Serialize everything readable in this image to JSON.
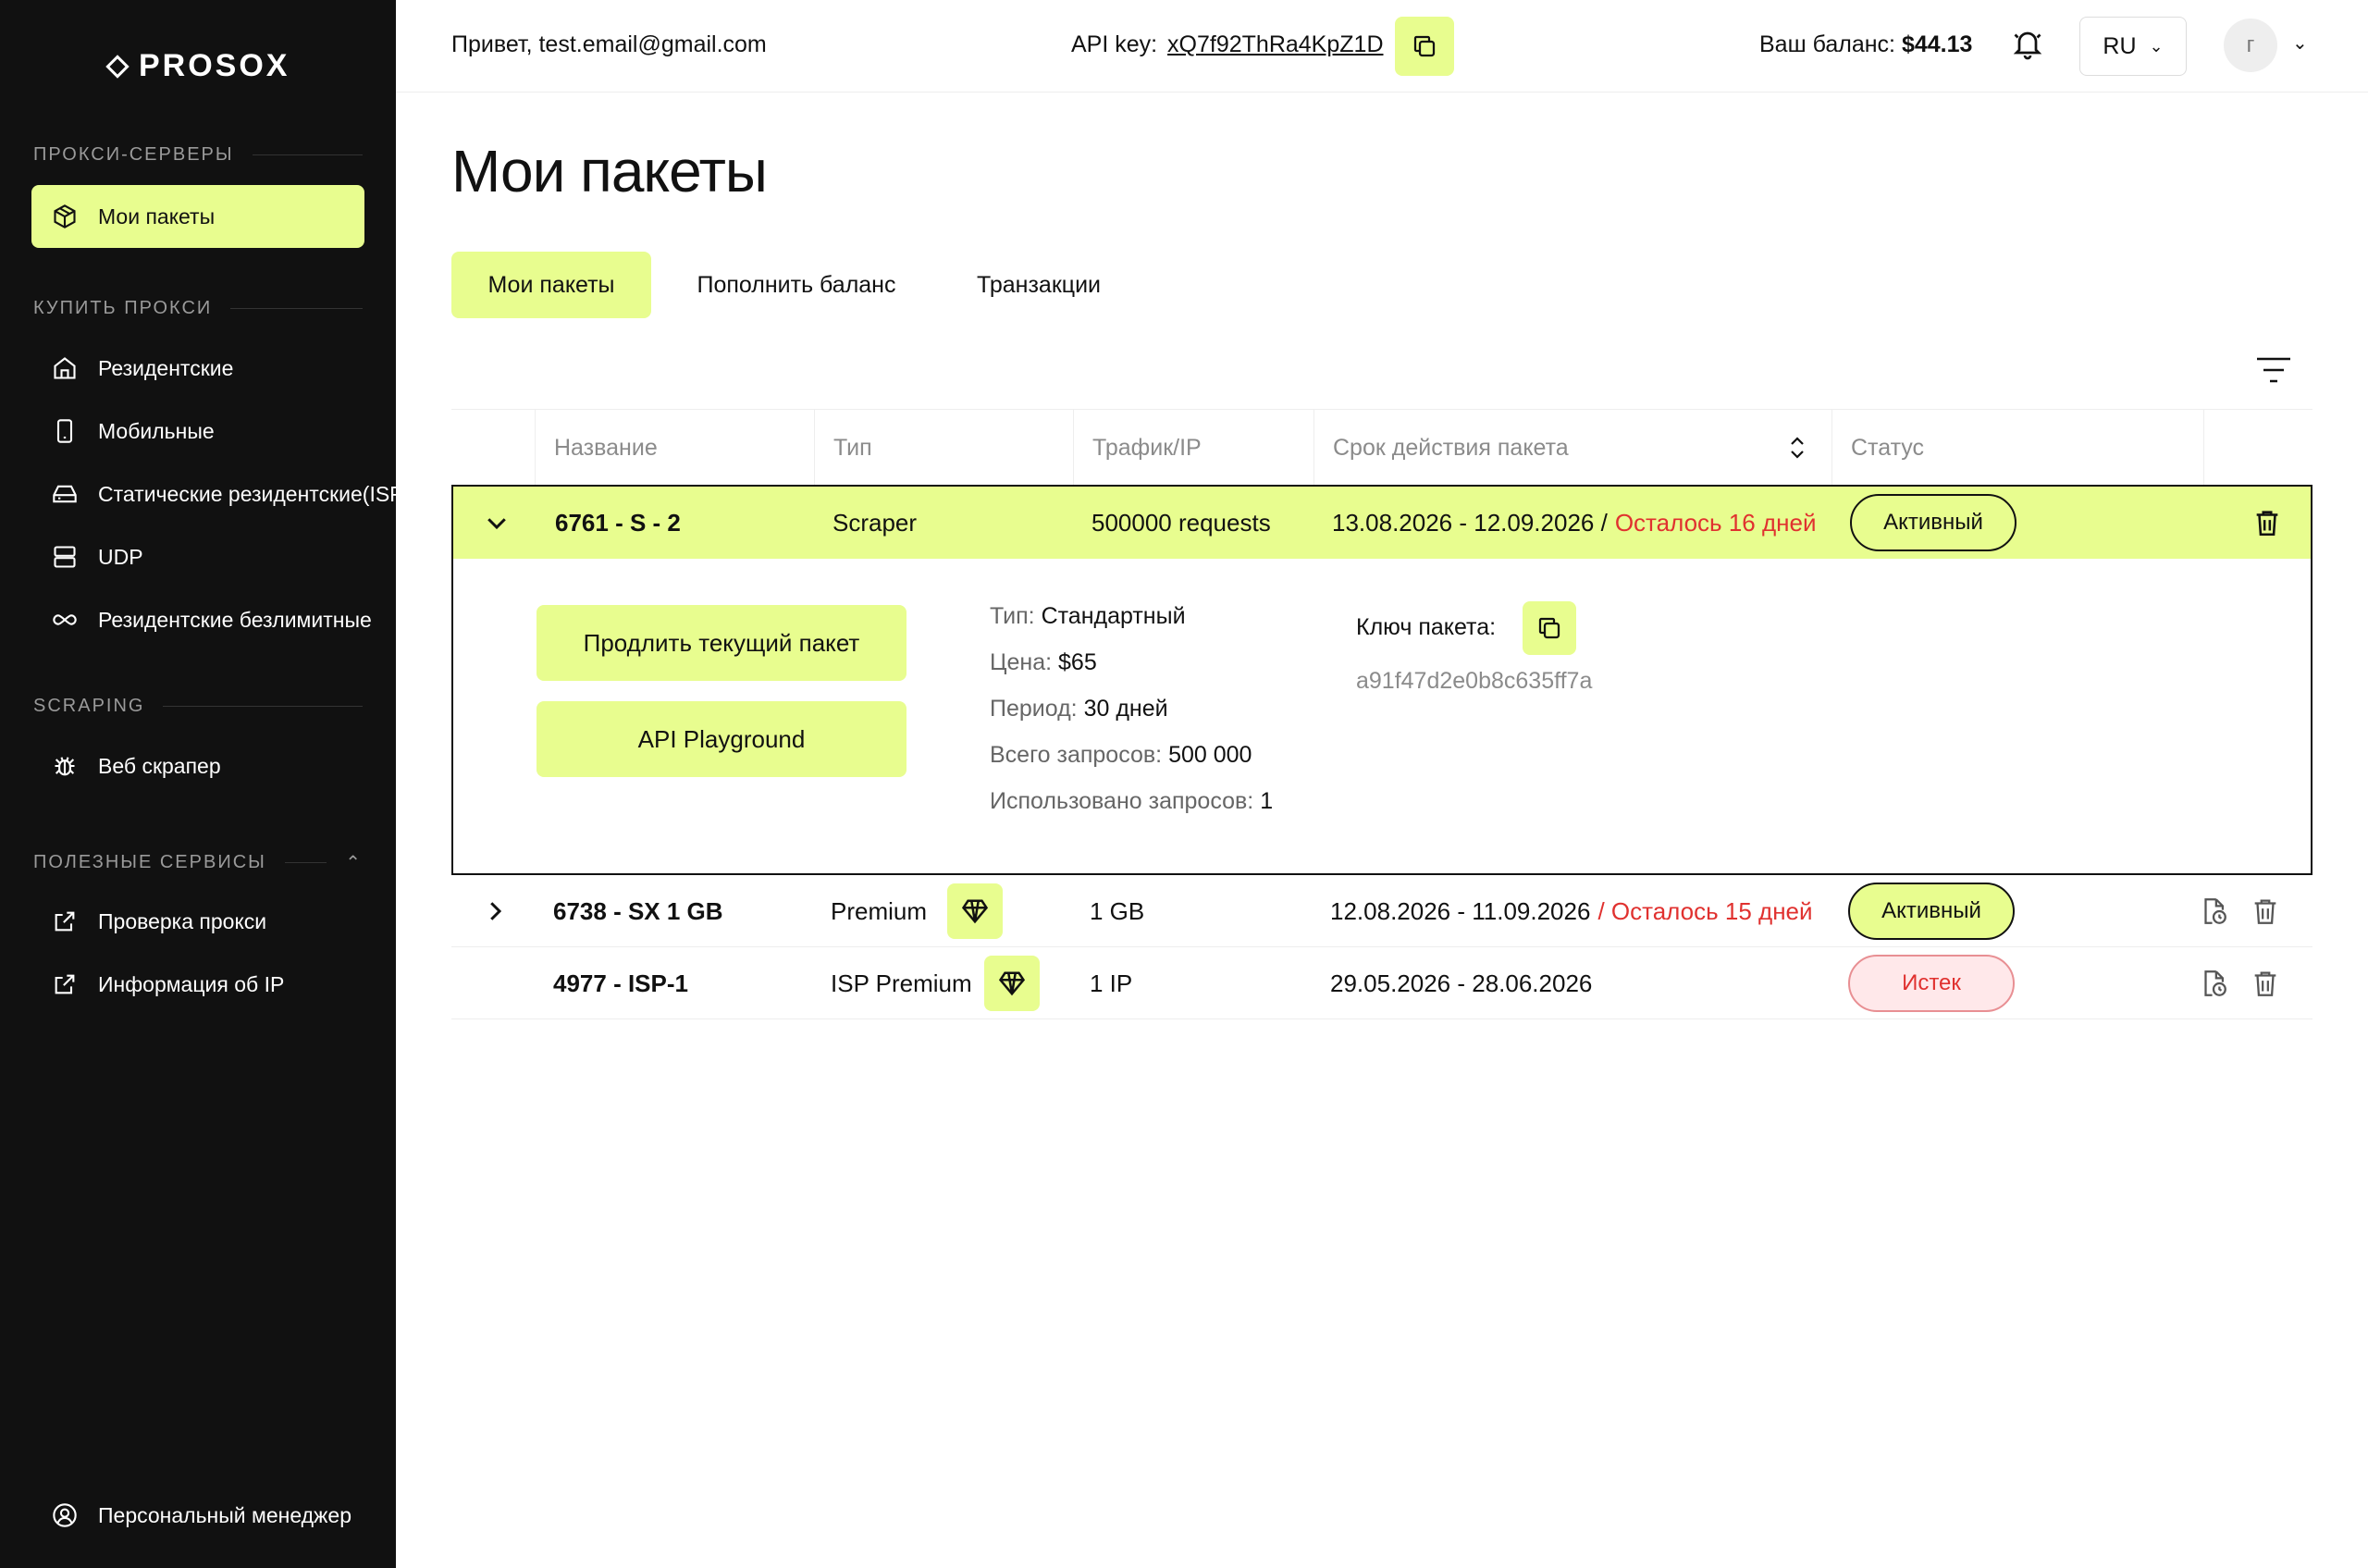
{
  "brand": {
    "name": "PROSOX"
  },
  "sidebar": {
    "sections": [
      {
        "title": "ПРОКСИ-СЕРВЕРЫ"
      },
      {
        "title": "КУПИТЬ ПРОКСИ"
      },
      {
        "title": "SCRAPING"
      },
      {
        "title": "ПОЛЕЗНЫЕ СЕРВИСЫ"
      }
    ],
    "items": [
      {
        "label": "Мои пакеты",
        "icon": "package-icon"
      },
      {
        "label": "Резидентские",
        "icon": "home-icon"
      },
      {
        "label": "Мобильные",
        "icon": "mobile-icon"
      },
      {
        "label": "Статические резидентские(ISP)",
        "icon": "hdd-icon"
      },
      {
        "label": "UDP",
        "icon": "server-icon"
      },
      {
        "label": "Резидентские безлимитные",
        "icon": "infinity-icon"
      },
      {
        "label": "Веб скрапер",
        "icon": "bug-icon"
      },
      {
        "label": "Проверка прокси",
        "icon": "external-link-icon"
      },
      {
        "label": "Информация об IP",
        "icon": "external-link-icon"
      }
    ],
    "manager": {
      "label": "Персональный менеджер",
      "icon": "user-circle-icon"
    }
  },
  "header": {
    "greeting": "Привет, test.email@gmail.com",
    "api_label": "API key:",
    "api_key": "xQ7f92ThRa4KpZ1D",
    "balance_label": "Ваш баланс:",
    "balance_value": "$44.13",
    "language": "RU",
    "avatar_letter": "г"
  },
  "page": {
    "title": "Мои пакеты",
    "tabs": [
      {
        "label": "Мои пакеты",
        "active": true
      },
      {
        "label": "Пополнить баланс",
        "active": false
      },
      {
        "label": "Транзакции",
        "active": false
      }
    ]
  },
  "table": {
    "columns": [
      "Название",
      "Тип",
      "Трафик/IP",
      "Срок действия пакета",
      "Статус"
    ],
    "rows": [
      {
        "name": "6761 - S - 2",
        "type": "Scraper",
        "traffic": "500000 requests",
        "period": "13.08.2026 - 12.09.2026",
        "sep": "/",
        "remaining": "Осталось 16 дней",
        "status": "Активный"
      },
      {
        "name": "6738 - SX 1 GB",
        "type": "Premium",
        "traffic": "1 GB",
        "period": "12.08.2026 - 11.09.2026",
        "remaining": "/ Осталось 15 дней",
        "status": "Активный"
      },
      {
        "name": "4977 - ISP-1",
        "type": "ISP Premium",
        "traffic": "1 IP",
        "period": "29.05.2026 - 28.06.2026",
        "remaining": "",
        "status": "Истек"
      }
    ],
    "expanded": {
      "extend_button": "Продлить текущий пакет",
      "playground_button": "API Playground",
      "details": [
        {
          "label": "Тип:",
          "value": "Стандартный"
        },
        {
          "label": "Цена:",
          "value": "$65"
        },
        {
          "label": "Период:",
          "value": "30 дней"
        },
        {
          "label": "Всего запросов:",
          "value": "500 000"
        },
        {
          "label": "Использовано запросов:",
          "value": "1"
        }
      ],
      "key_label": "Ключ пакета:",
      "key_value": "a91f47d2e0b8c635ff7a"
    }
  },
  "colors": {
    "accent": "#e8fd8f",
    "sidebar_bg": "#111111",
    "danger": "#e0312f"
  }
}
